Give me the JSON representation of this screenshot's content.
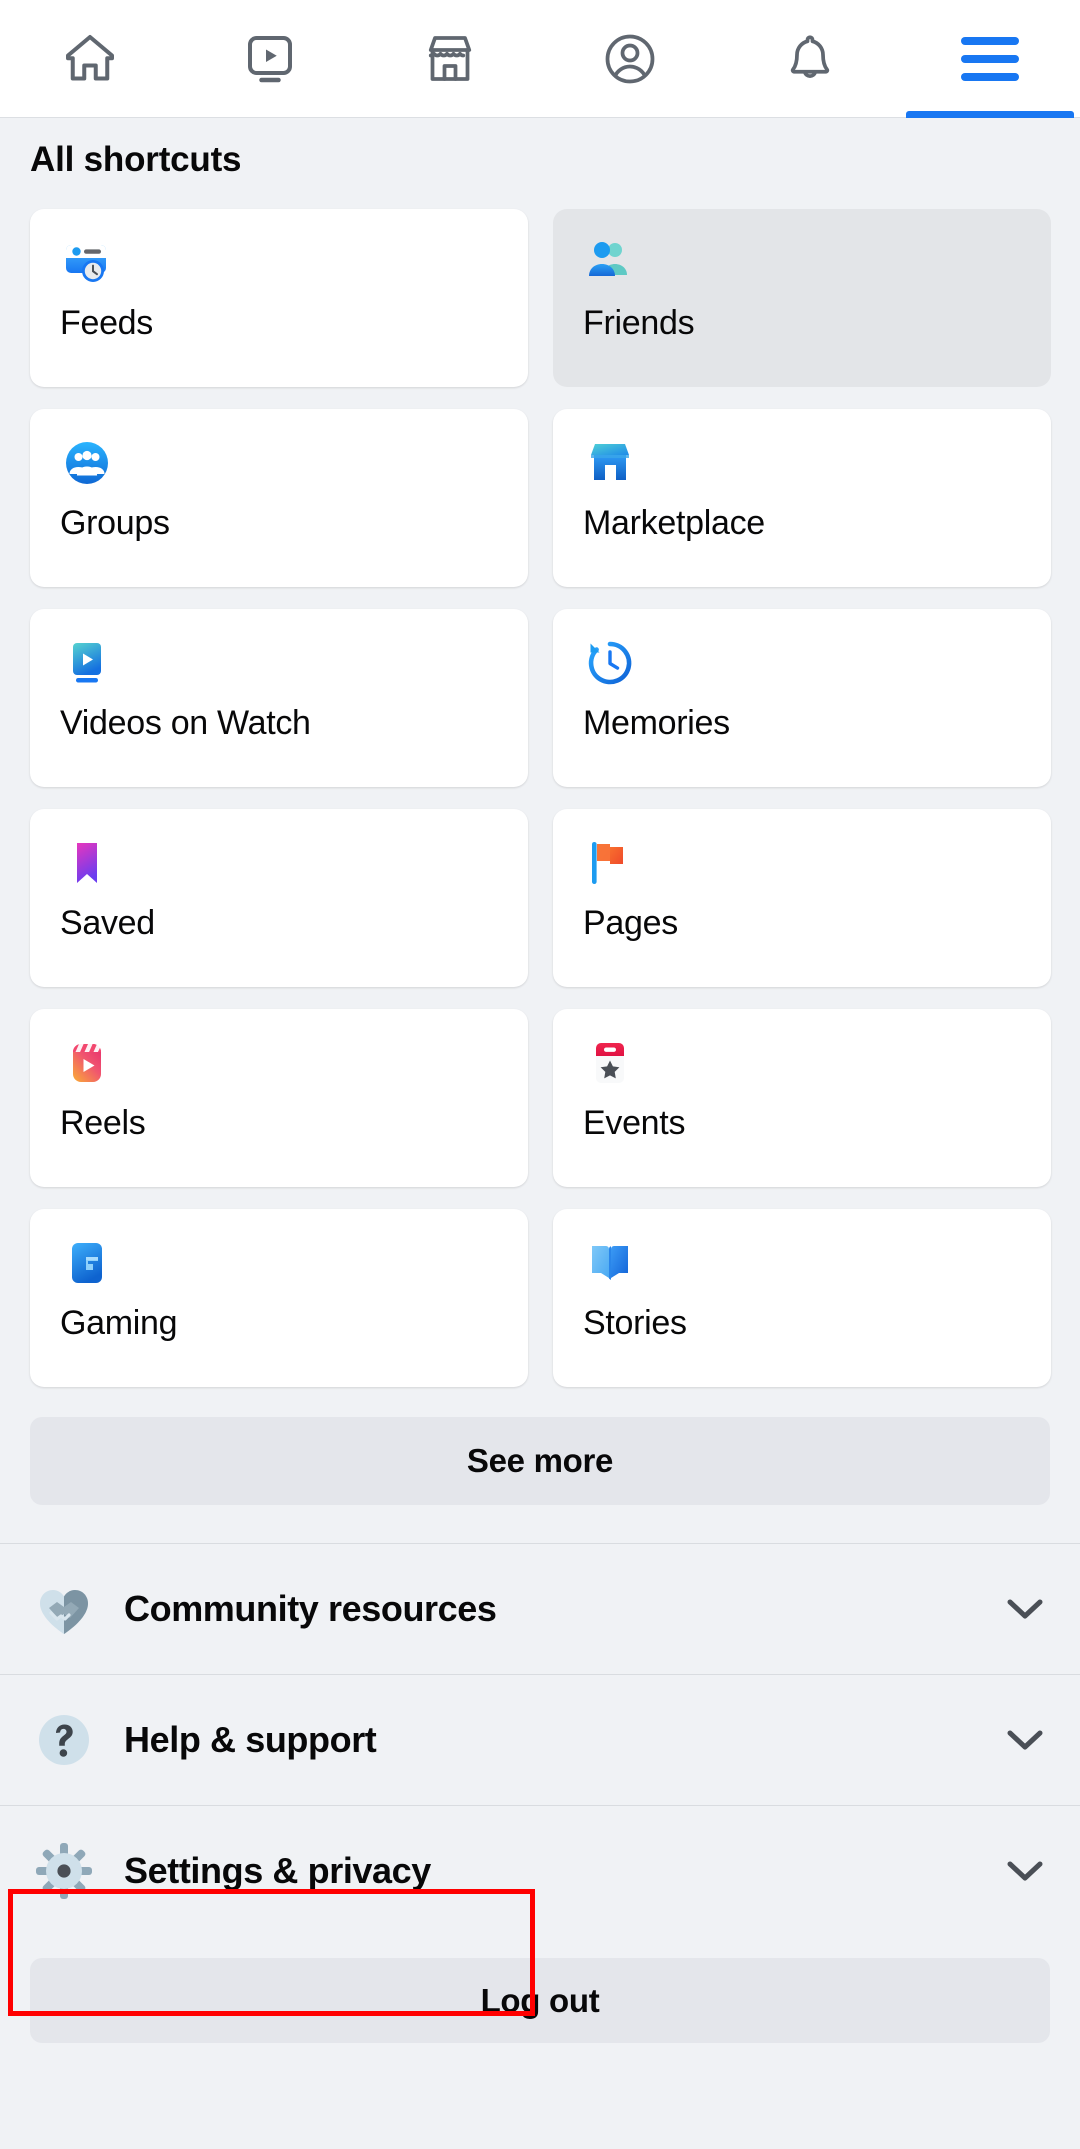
{
  "topnav": {
    "tabs": [
      {
        "name": "home",
        "icon": "home-icon",
        "active": false
      },
      {
        "name": "video",
        "icon": "video-icon",
        "active": false
      },
      {
        "name": "marketplace",
        "icon": "store-icon",
        "active": false
      },
      {
        "name": "profile",
        "icon": "account-circle-icon",
        "active": false
      },
      {
        "name": "notifications",
        "icon": "bell-icon",
        "active": false
      },
      {
        "name": "menu",
        "icon": "hamburger-menu-icon",
        "active": true
      }
    ],
    "active_color": "#1877f2",
    "inactive_color": "#606770"
  },
  "shortcuts": {
    "title": "All shortcuts",
    "items": [
      {
        "label": "Feeds",
        "icon": "feeds-icon",
        "pressed": false
      },
      {
        "label": "Friends",
        "icon": "friends-icon",
        "pressed": true
      },
      {
        "label": "Groups",
        "icon": "groups-icon",
        "pressed": false
      },
      {
        "label": "Marketplace",
        "icon": "marketplace-icon",
        "pressed": false
      },
      {
        "label": "Videos on Watch",
        "icon": "watch-icon",
        "pressed": false
      },
      {
        "label": "Memories",
        "icon": "memories-icon",
        "pressed": false
      },
      {
        "label": "Saved",
        "icon": "saved-icon",
        "pressed": false
      },
      {
        "label": "Pages",
        "icon": "pages-icon",
        "pressed": false
      },
      {
        "label": "Reels",
        "icon": "reels-icon",
        "pressed": false
      },
      {
        "label": "Events",
        "icon": "events-icon",
        "pressed": false
      },
      {
        "label": "Gaming",
        "icon": "gaming-icon",
        "pressed": false
      },
      {
        "label": "Stories",
        "icon": "stories-icon",
        "pressed": false
      }
    ],
    "see_more_label": "See more"
  },
  "menu_rows": [
    {
      "label": "Community resources",
      "icon": "handshake-heart-icon",
      "expanded": false,
      "highlighted": false
    },
    {
      "label": "Help & support",
      "icon": "question-mark-icon",
      "expanded": false,
      "highlighted": false
    },
    {
      "label": "Settings & privacy",
      "icon": "gear-icon",
      "expanded": false,
      "highlighted": true
    }
  ],
  "footer": {
    "logout_label": "Log out"
  },
  "annotation": {
    "color": "#ff0000",
    "target": "Settings & privacy"
  },
  "colors": {
    "page_background": "#f0f2f5",
    "card_background": "#ffffff",
    "card_pressed": "#e3e5e8",
    "button_background": "#e4e6eb",
    "brand_blue": "#1877f2",
    "text_primary": "#080809",
    "divider": "#d9dce0"
  }
}
